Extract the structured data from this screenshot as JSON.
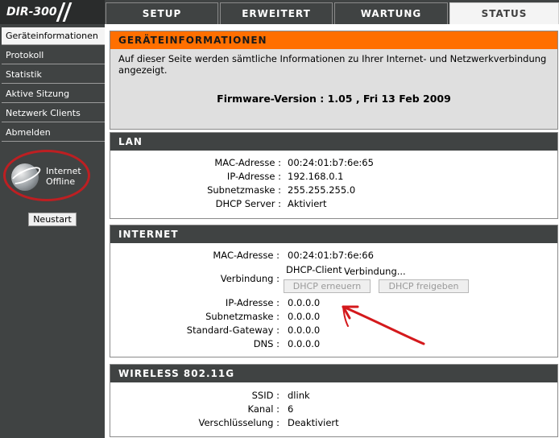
{
  "header": {
    "logo": "DIR-300",
    "tabs": [
      "SETUP",
      "ERWEITERT",
      "WARTUNG",
      "STATUS"
    ],
    "active_tab": "STATUS"
  },
  "sidebar": {
    "items": [
      {
        "label": "Geräteinformationen",
        "active": true
      },
      {
        "label": "Protokoll"
      },
      {
        "label": "Statistik"
      },
      {
        "label": "Aktive Sitzung"
      },
      {
        "label": "Netzwerk Clients"
      },
      {
        "label": "Abmelden"
      }
    ],
    "status_line1": "Internet",
    "status_line2": "Offline",
    "restart_label": "Neustart"
  },
  "info": {
    "title": "GERÄTEINFORMATIONEN",
    "description": "Auf dieser Seite werden sämtliche Informationen zu Ihrer Internet- und Netzwerkverbindung angezeigt.",
    "firmware": "Firmware-Version : 1.05 ,  Fri 13 Feb 2009"
  },
  "lan": {
    "title": "LAN",
    "mac_label": "MAC-Adresse :",
    "mac": "00:24:01:b7:6e:65",
    "ip_label": "IP-Adresse :",
    "ip": "192.168.0.1",
    "subnet_label": "Subnetzmaske :",
    "subnet": "255.255.255.0",
    "dhcp_label": "DHCP Server :",
    "dhcp": "Aktiviert"
  },
  "internet": {
    "title": "INTERNET",
    "mac_label": "MAC-Adresse :",
    "mac": "00:24:01:b7:6e:66",
    "conn_label": "Verbindung :",
    "conn_type": "DHCP-Client",
    "conn_status": "Verbindung...",
    "renew_label": "DHCP erneuern",
    "release_label": "DHCP freigeben",
    "ip_label": "IP-Adresse :",
    "ip": "0.0.0.0",
    "subnet_label": "Subnetzmaske :",
    "subnet": "0.0.0.0",
    "gateway_label": "Standard-Gateway :",
    "gateway": "0.0.0.0",
    "dns_label": "DNS :",
    "dns": "0.0.0.0"
  },
  "wireless": {
    "title": "WIRELESS 802.11G",
    "ssid_label": "SSID :",
    "ssid": "dlink",
    "channel_label": "Kanal :",
    "channel": "6",
    "encryption_label": "Verschlüsselung :",
    "encryption": "Deaktiviert"
  },
  "colors": {
    "nav_bg": "#404343",
    "accent_orange": "#ff6f00",
    "annotation_red": "#d4191c"
  }
}
